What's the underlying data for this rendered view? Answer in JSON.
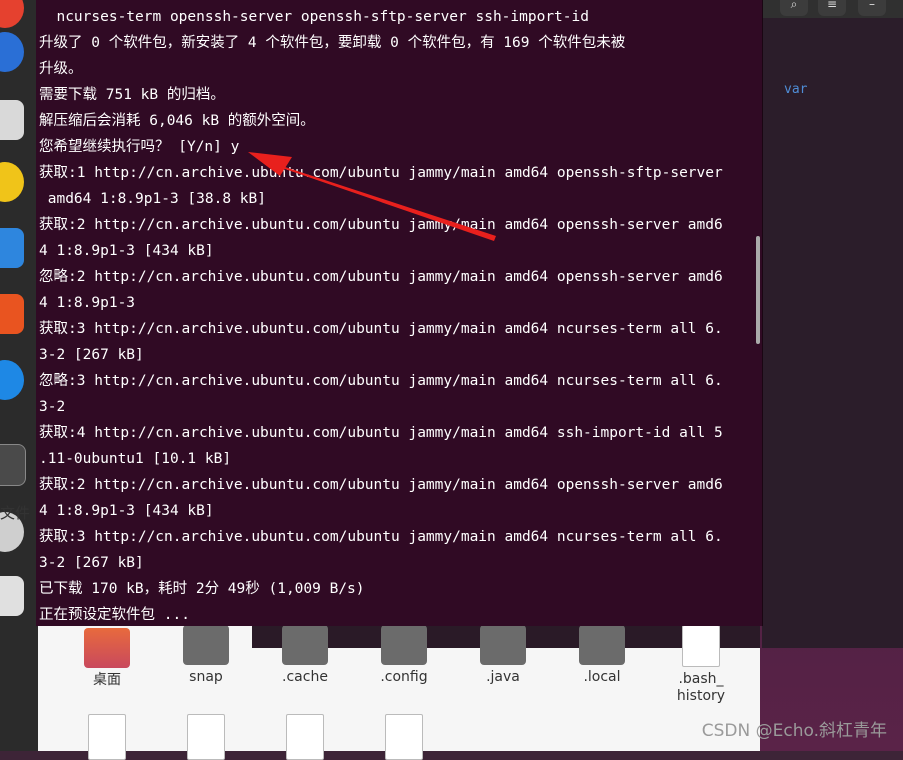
{
  "terminal": {
    "lines": [
      "  ncurses-term openssh-server openssh-sftp-server ssh-import-id",
      "升级了 0 个软件包，新安装了 4 个软件包，要卸载 0 个软件包，有 169 个软件包未被",
      "升级。",
      "需要下载 751 kB 的归档。",
      "解压缩后会消耗 6,046 kB 的额外空间。",
      "您希望继续执行吗？ [Y/n] y",
      "获取:1 http://cn.archive.ubuntu.com/ubuntu jammy/main amd64 openssh-sftp-server",
      " amd64 1:8.9p1-3 [38.8 kB]",
      "获取:2 http://cn.archive.ubuntu.com/ubuntu jammy/main amd64 openssh-server amd6",
      "4 1:8.9p1-3 [434 kB]",
      "忽略:2 http://cn.archive.ubuntu.com/ubuntu jammy/main amd64 openssh-server amd6",
      "4 1:8.9p1-3",
      "获取:3 http://cn.archive.ubuntu.com/ubuntu jammy/main amd64 ncurses-term all 6.",
      "3-2 [267 kB]",
      "忽略:3 http://cn.archive.ubuntu.com/ubuntu jammy/main amd64 ncurses-term all 6.",
      "3-2",
      "获取:4 http://cn.archive.ubuntu.com/ubuntu jammy/main amd64 ssh-import-id all 5",
      ".11-0ubuntu1 [10.1 kB]",
      "获取:2 http://cn.archive.ubuntu.com/ubuntu jammy/main amd64 openssh-server amd6",
      "4 1:8.9p1-3 [434 kB]",
      "获取:3 http://cn.archive.ubuntu.com/ubuntu jammy/main amd64 ncurses-term all 6.",
      "3-2 [267 kB]",
      "已下载 170 kB，耗时 2分 49秒 (1,009 B/s)",
      "正在预设定软件包 ..."
    ]
  },
  "background_editor": {
    "keyword": "var"
  },
  "files": {
    "items": [
      {
        "label": "桌面",
        "icon": "home-folder-icon"
      },
      {
        "label": "snap",
        "icon": "folder-icon"
      },
      {
        "label": ".cache",
        "icon": "folder-icon"
      },
      {
        "label": ".config",
        "icon": "folder-icon"
      },
      {
        "label": ".java",
        "icon": "folder-icon"
      },
      {
        "label": ".local",
        "icon": "folder-icon"
      },
      {
        "label": ".bash_\nhistory",
        "icon": "text-file-icon"
      }
    ]
  },
  "dock": {
    "partial_label": "文件",
    "icons": [
      "firefox-icon",
      "thunderbird-icon",
      "files-icon",
      "rhythmbox-icon",
      "libreoffice-writer-icon",
      "app-center-icon",
      "help-icon",
      "window-icon",
      "dvd-icon",
      "trash-icon"
    ]
  },
  "watermark": "CSDN @Echo.斜杠青年",
  "colors": {
    "terminal_bg": "#300a24",
    "text": "#ffffff",
    "arrow": "#e8201d"
  }
}
